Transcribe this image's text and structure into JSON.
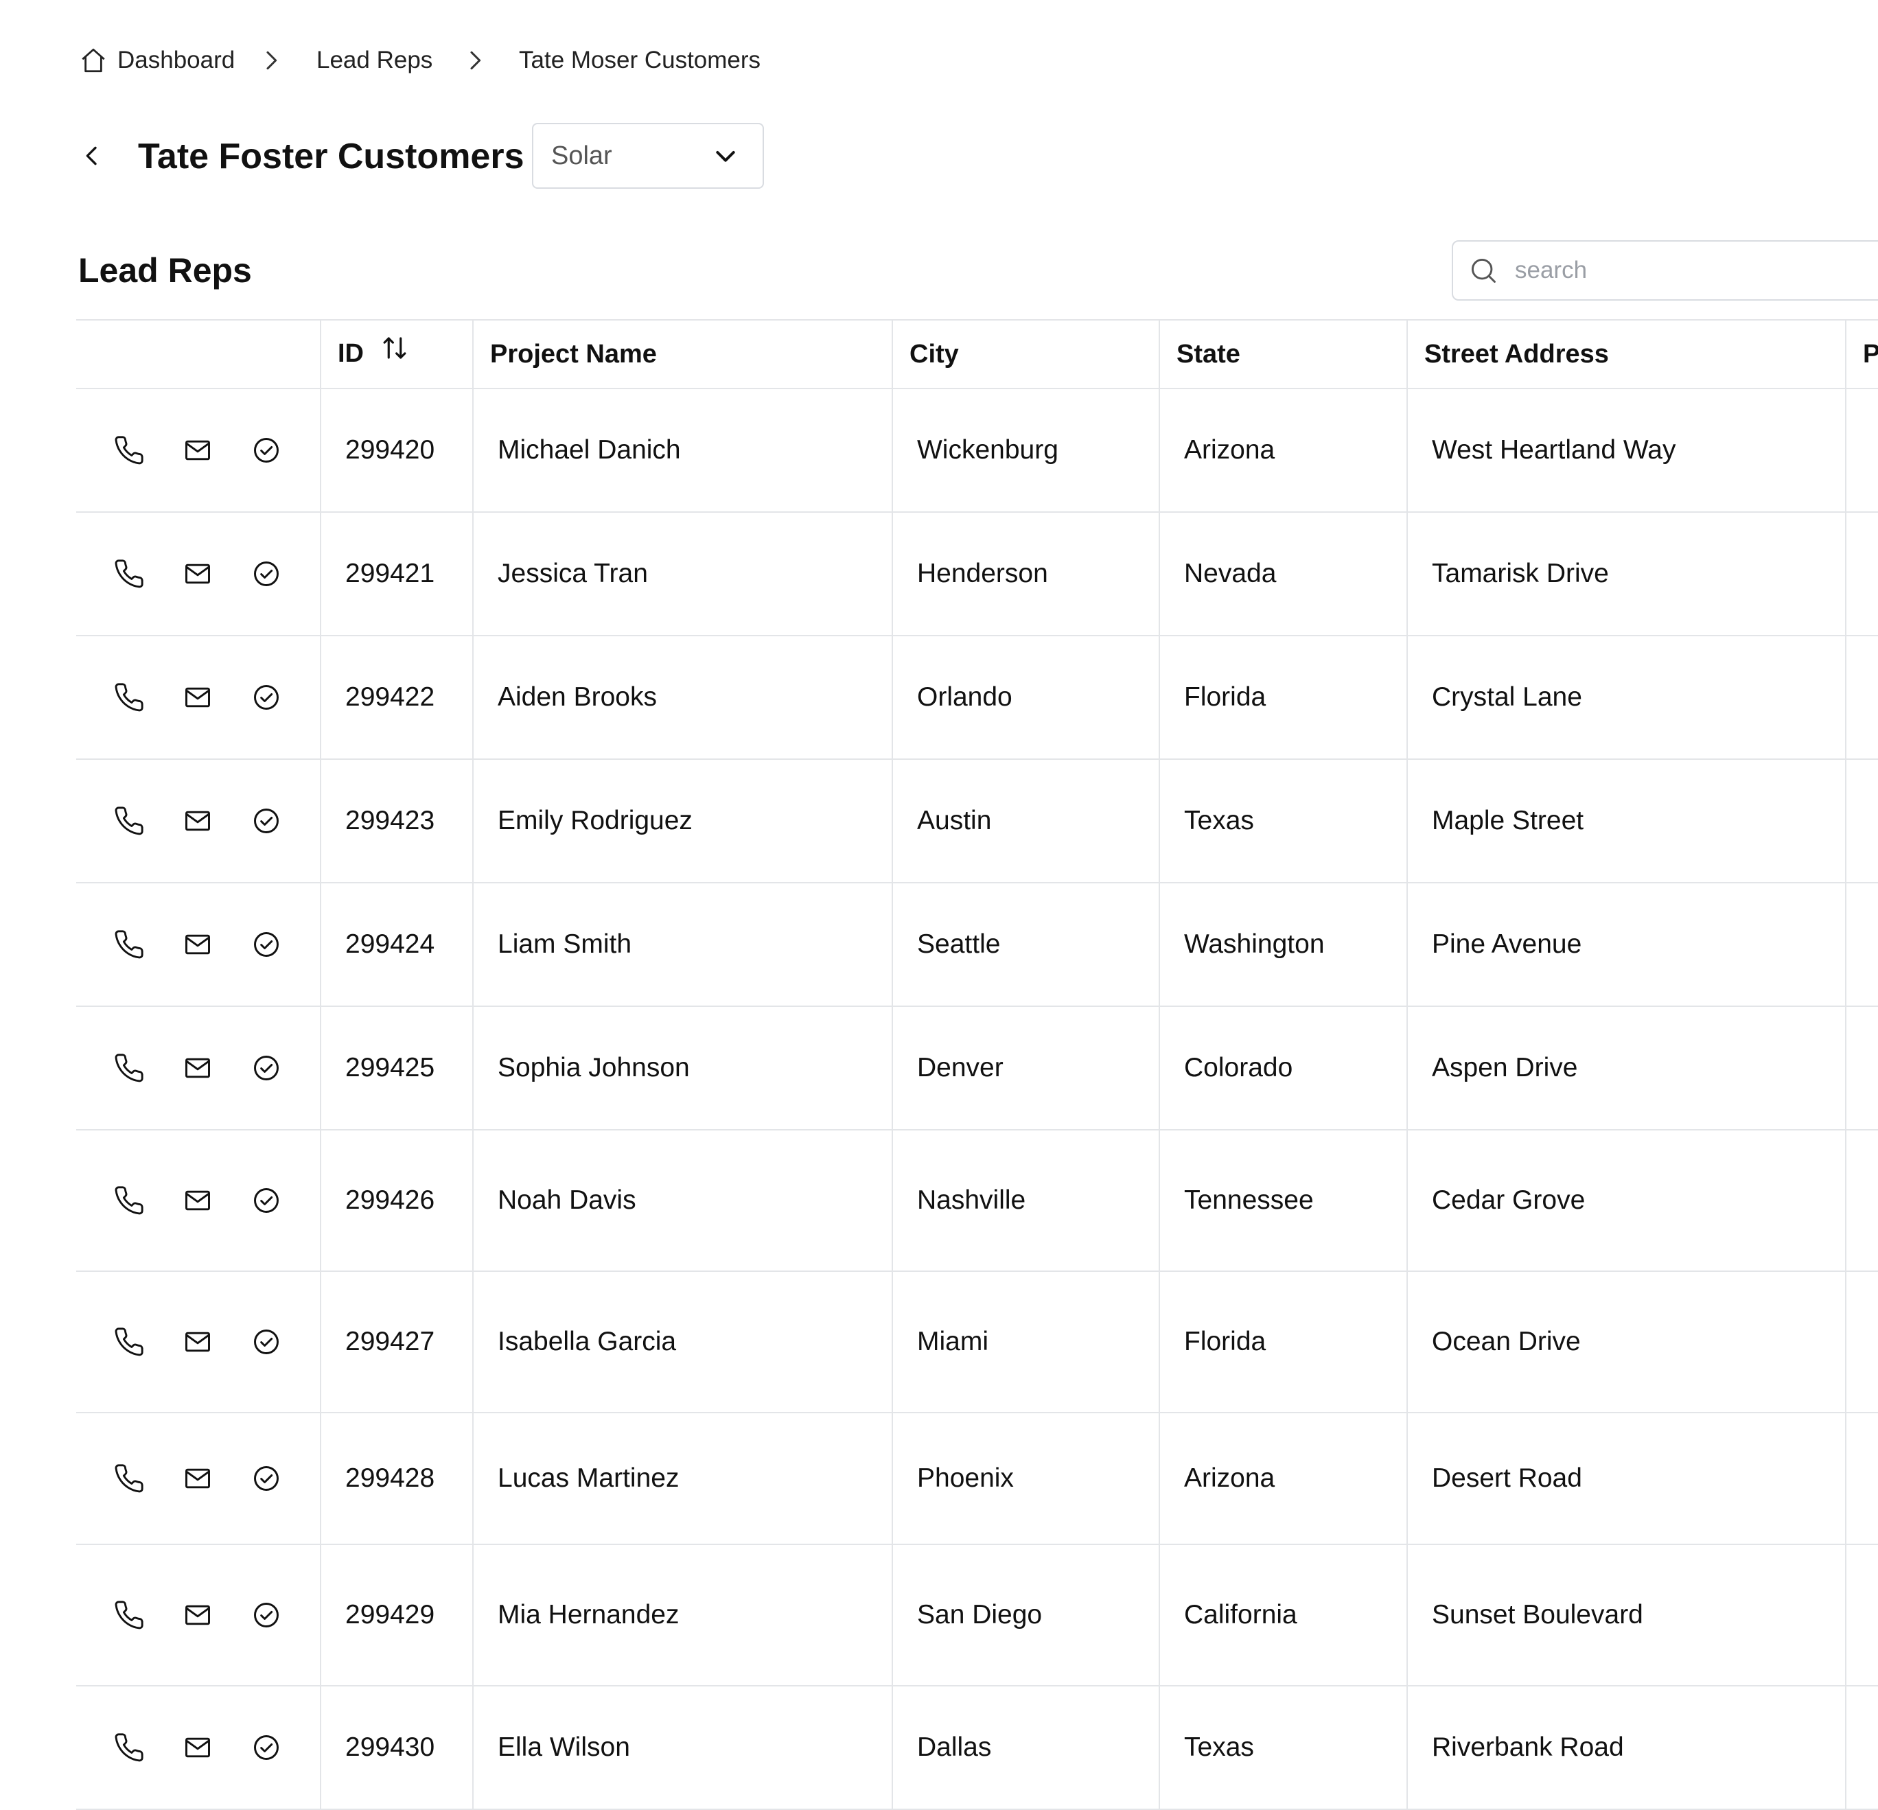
{
  "breadcrumb": {
    "items": [
      {
        "label": "Dashboard"
      },
      {
        "label": "Lead Reps"
      },
      {
        "label": "Tate Moser Customers"
      }
    ]
  },
  "header": {
    "title": "Tate Foster Customers",
    "category_select": {
      "value": "Solar"
    }
  },
  "section": {
    "title": "Lead Reps",
    "search": {
      "placeholder": "search",
      "value": ""
    }
  },
  "table": {
    "columns": [
      "",
      "ID",
      "Project Name",
      "City",
      "State",
      "Street Address",
      "P"
    ],
    "sorted_column": "ID",
    "rows": [
      {
        "id": "299420",
        "project": "Michael Danich",
        "city": "Wickenburg",
        "state": "Arizona",
        "street": "West Heartland Way"
      },
      {
        "id": "299421",
        "project": "Jessica Tran",
        "city": "Henderson",
        "state": "Nevada",
        "street": "Tamarisk Drive"
      },
      {
        "id": "299422",
        "project": "Aiden Brooks",
        "city": "Orlando",
        "state": "Florida",
        "street": "Crystal Lane"
      },
      {
        "id": "299423",
        "project": "Emily Rodriguez",
        "city": "Austin",
        "state": "Texas",
        "street": "Maple Street"
      },
      {
        "id": "299424",
        "project": "Liam Smith",
        "city": "Seattle",
        "state": "Washington",
        "street": "Pine Avenue"
      },
      {
        "id": "299425",
        "project": "Sophia Johnson",
        "city": "Denver",
        "state": "Colorado",
        "street": "Aspen Drive"
      },
      {
        "id": "299426",
        "project": "Noah Davis",
        "city": "Nashville",
        "state": "Tennessee",
        "street": "Cedar Grove"
      },
      {
        "id": "299427",
        "project": "Isabella Garcia",
        "city": "Miami",
        "state": "Florida",
        "street": "Ocean Drive"
      },
      {
        "id": "299428",
        "project": "Lucas Martinez",
        "city": "Phoenix",
        "state": "Arizona",
        "street": "Desert Road"
      },
      {
        "id": "299429",
        "project": "Mia Hernandez",
        "city": "San Diego",
        "state": "California",
        "street": "Sunset Boulevard"
      },
      {
        "id": "299430",
        "project": "Ella Wilson",
        "city": "Dallas",
        "state": "Texas",
        "street": "Riverbank Road"
      }
    ],
    "row_actions": [
      "phone-icon",
      "mail-icon",
      "check-circle-icon"
    ]
  },
  "colors": {
    "border": "#e3e5e8",
    "text": "#111111",
    "muted": "#9a9ea5"
  }
}
